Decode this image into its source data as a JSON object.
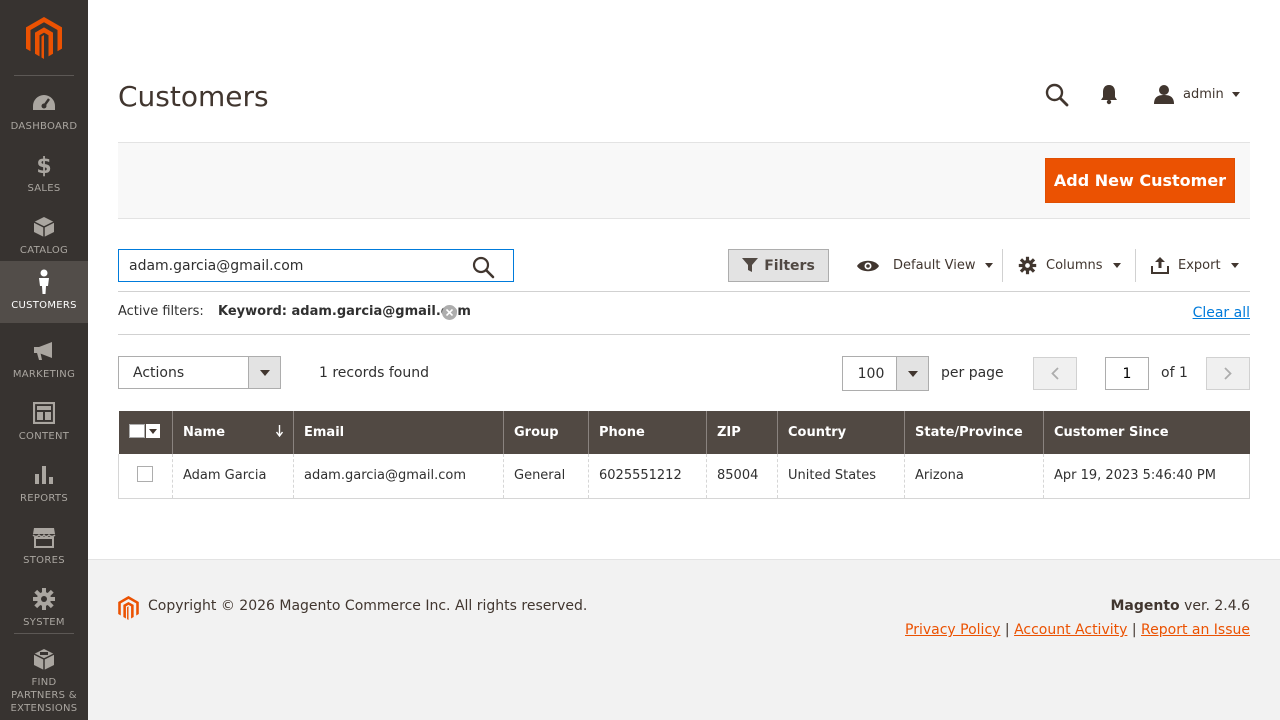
{
  "sidebar": {
    "logo": "magento-logo",
    "items": [
      {
        "label": "Dashboard",
        "icon": "dashboard-icon"
      },
      {
        "label": "Sales",
        "icon": "dollar-icon"
      },
      {
        "label": "Catalog",
        "icon": "box-icon"
      },
      {
        "label": "Customers",
        "icon": "person-icon",
        "active": true
      },
      {
        "label": "Marketing",
        "icon": "megaphone-icon"
      },
      {
        "label": "Content",
        "icon": "content-icon"
      },
      {
        "label": "Reports",
        "icon": "bar-chart-icon"
      },
      {
        "label": "Stores",
        "icon": "store-icon"
      },
      {
        "label": "System",
        "icon": "gear-icon"
      },
      {
        "label": "Find Partners & Extensions",
        "icon": "extensions-icon"
      }
    ]
  },
  "header": {
    "title": "Customers",
    "user": "admin"
  },
  "action_bar": {
    "add_label": "Add New Customer"
  },
  "toolbar": {
    "search_value": "adam.garcia@gmail.com",
    "filters_label": "Filters",
    "view_label": "Default View",
    "columns_label": "Columns",
    "export_label": "Export"
  },
  "active_filters": {
    "label": "Active filters:",
    "keyword": "Keyword: adam.garcia@gmail.com",
    "clear_label": "Clear all"
  },
  "grid_controls": {
    "actions_label": "Actions",
    "records": "1 records found",
    "per_page_value": "100",
    "per_page_label": "per page",
    "page_value": "1",
    "page_of": "of 1"
  },
  "table": {
    "columns": [
      "Name",
      "Email",
      "Group",
      "Phone",
      "ZIP",
      "Country",
      "State/Province",
      "Customer Since"
    ],
    "rows": [
      [
        "Adam Garcia",
        "adam.garcia@gmail.com",
        "General",
        "6025551212",
        "85004",
        "United States",
        "Arizona",
        "Apr 19, 2023 5:46:40 PM"
      ]
    ]
  },
  "footer": {
    "copyright": "Copyright © 2026 Magento Commerce Inc. All rights reserved.",
    "brand": "Magento",
    "version": " ver. 2.4.6",
    "links": [
      "Privacy Policy",
      "Account Activity",
      "Report an Issue"
    ]
  },
  "colors": {
    "sidebar_bg": "#373330",
    "accent": "#eb5202",
    "table_header": "#514943",
    "link": "#007bdb"
  }
}
